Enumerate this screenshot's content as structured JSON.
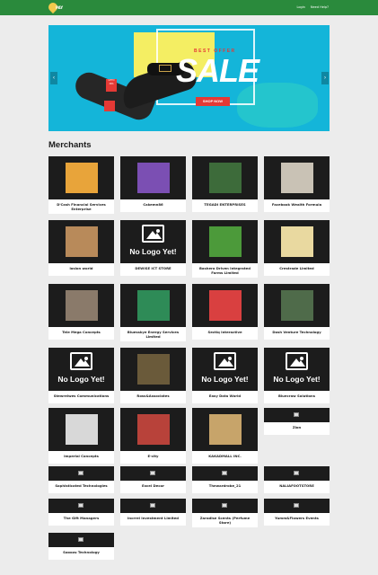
{
  "header": {
    "logo_text": "PAY",
    "nav": [
      "Login",
      "Need Help?"
    ]
  },
  "banner": {
    "best_offer": "BEST OFFER",
    "sale": "SALE",
    "shop_now": "SHOP NOW",
    "tag_text": "UPTO 30%",
    "prev_icon": "chevron-left-icon",
    "next_icon": "chevron-right-icon"
  },
  "merchants_title": "Merchants",
  "no_logo_text": "No Logo Yet!",
  "merchants": [
    {
      "name": "D'Cash Financial Services Enterprise",
      "logo": "image",
      "color": "#e8a43a"
    },
    {
      "name": "Cakemn86",
      "logo": "image",
      "color": "#7b4fb3"
    },
    {
      "name": "TEGADI ENTERPRISES",
      "logo": "image",
      "color": "#3d6b3a"
    },
    {
      "name": "Facebook Wealth Formula",
      "logo": "image",
      "color": "#c9c2b5"
    },
    {
      "name": "lasion world",
      "logo": "image",
      "color": "#b88a5a"
    },
    {
      "name": "DEWISE ICT STORE",
      "logo": "none"
    },
    {
      "name": "Bashera Driven Integrated Farms Limited",
      "logo": "image",
      "color": "#4c9a3a"
    },
    {
      "name": "Crestrade Limited",
      "logo": "image",
      "color": "#e9d9a0"
    },
    {
      "name": "Tele Mega Concepts",
      "logo": "image",
      "color": "#8a7a6a"
    },
    {
      "name": "Bluesskye Energy Services Limited",
      "logo": "image",
      "color": "#2e8b57"
    },
    {
      "name": "Sectiq Interactive",
      "logo": "image",
      "color": "#d94040"
    },
    {
      "name": "Dosh Venture Technology",
      "logo": "image",
      "color": "#4f6b4a"
    },
    {
      "name": "Stewrelwes Communications",
      "logo": "none"
    },
    {
      "name": "Ross&Associates",
      "logo": "image",
      "color": "#6a5a3a"
    },
    {
      "name": "Easy Data World",
      "logo": "none"
    },
    {
      "name": "Bluecraw Solutions",
      "logo": "none"
    },
    {
      "name": "Imperial Concepts",
      "logo": "image",
      "color": "#d8d8d8"
    },
    {
      "name": "E-city",
      "logo": "image",
      "color": "#b8423a"
    },
    {
      "name": "KAKADMALL INC.",
      "logo": "image",
      "color": "#c7a46a"
    },
    {
      "name": "Zion",
      "logo": "broken"
    },
    {
      "name": "Sophisticated Technologies",
      "logo": "broken"
    },
    {
      "name": "Excel Decor",
      "logo": "broken"
    },
    {
      "name": "Thewardrobe_21",
      "logo": "broken"
    },
    {
      "name": "NALIAFOOTSTORE",
      "logo": "broken"
    },
    {
      "name": "The Gift Managers",
      "logo": "broken"
    },
    {
      "name": "Incrrel Investment Limited",
      "logo": "broken"
    },
    {
      "name": "Zaradise Scents (Perfume Store)",
      "logo": "broken"
    },
    {
      "name": "Yumm&Flowers Events",
      "logo": "broken"
    },
    {
      "name": "Sooozu Technology",
      "logo": "broken"
    }
  ]
}
